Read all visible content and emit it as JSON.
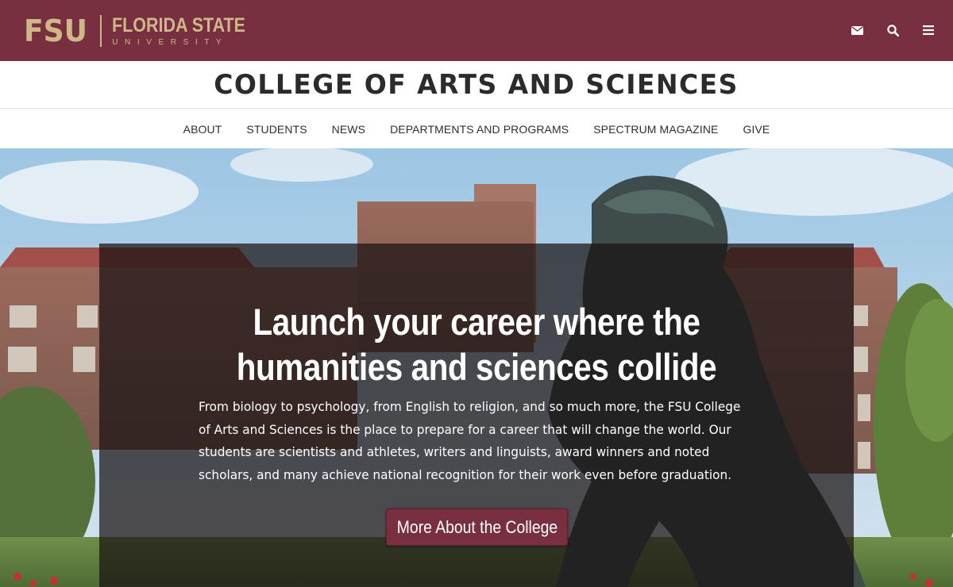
{
  "header": {
    "logo_mark": "FSU",
    "logo_name": "FLORIDA STATE",
    "logo_sub": "UNIVERSITY",
    "icons": [
      "mail-icon",
      "search-icon",
      "menu-icon"
    ]
  },
  "college": {
    "title": "COLLEGE OF ARTS AND SCIENCES"
  },
  "nav": {
    "items": [
      {
        "label": "ABOUT"
      },
      {
        "label": "STUDENTS"
      },
      {
        "label": "NEWS"
      },
      {
        "label": "DEPARTMENTS AND PROGRAMS"
      },
      {
        "label": "SPECTRUM MAGAZINE"
      },
      {
        "label": "GIVE"
      }
    ]
  },
  "hero": {
    "title_line1": "Launch your career where the",
    "title_line2": "humanities and sciences collide",
    "body": "From biology to psychology, from English to religion, and so much more, the FSU College of Arts and Sciences is the place to prepare for a career that will change the world. Our students are scientists and athletes, writers and linguists, award winners and noted scholars, and many achieve national recognition for their work even before graduation.",
    "button_label": "More About the College"
  },
  "colors": {
    "garnet": "#782f40",
    "gold": "#ceb888",
    "text_dark": "#2b2b2b"
  }
}
